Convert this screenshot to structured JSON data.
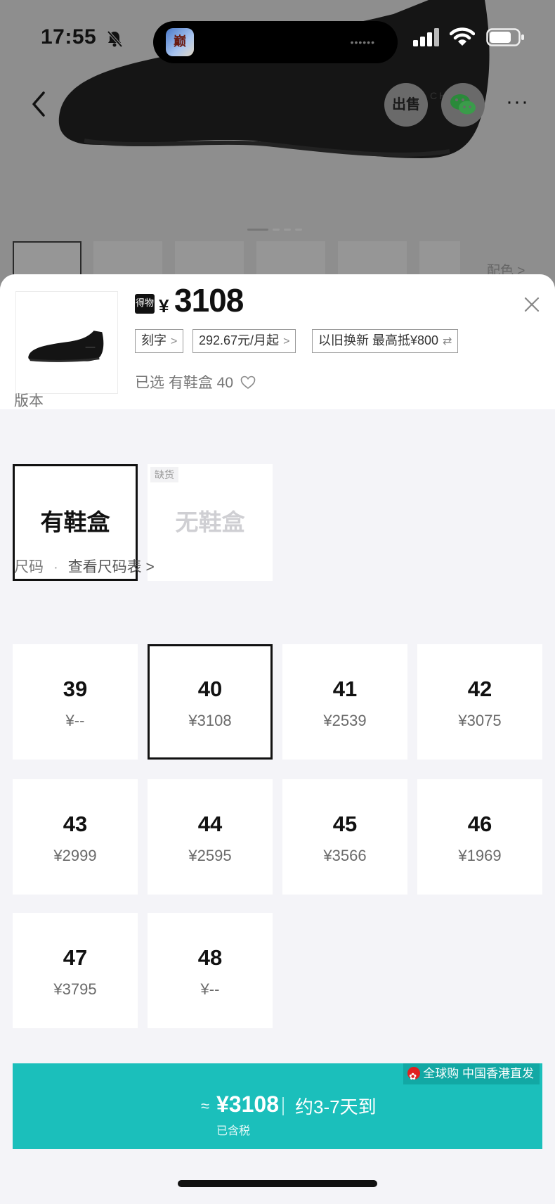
{
  "status_bar": {
    "time": "17:55"
  },
  "background_page": {
    "sell_label": "出售",
    "brand_fragment": "CH",
    "more_label": "···",
    "color_link": "配色 >"
  },
  "sheet": {
    "badge_label": "得物",
    "currency": "¥",
    "price": "3108",
    "tags": [
      {
        "label": "刻字",
        "chevron": ">"
      },
      {
        "label": "292.67元/月起",
        "chevron": ">"
      },
      {
        "label": "以旧换新 最高抵¥800",
        "chevron": "⇄"
      }
    ],
    "selected_info": "已选 有鞋盒 40"
  },
  "version_section": {
    "label": "版本",
    "options": [
      {
        "label": "有鞋盒",
        "state": "selected"
      },
      {
        "label": "无鞋盒",
        "state": "disabled",
        "tag": "缺货"
      }
    ]
  },
  "size_section": {
    "label": "尺码",
    "separator": "·",
    "size_chart_link": "查看尺码表 >",
    "sizes": [
      {
        "size": "39",
        "price": "¥--"
      },
      {
        "size": "40",
        "price": "¥3108",
        "selected": true
      },
      {
        "size": "41",
        "price": "¥2539"
      },
      {
        "size": "42",
        "price": "¥3075"
      },
      {
        "size": "43",
        "price": "¥2999"
      },
      {
        "size": "44",
        "price": "¥2595"
      },
      {
        "size": "45",
        "price": "¥3566"
      },
      {
        "size": "46",
        "price": "¥1969"
      },
      {
        "size": "47",
        "price": "¥3795"
      },
      {
        "size": "48",
        "price": "¥--"
      }
    ]
  },
  "buy_button": {
    "badge": "全球购 中国香港直发",
    "approx": "≈",
    "price": "¥3108",
    "delivery": "约3-7天到",
    "tax_note": "已含税"
  },
  "colors": {
    "accent": "#1bbfbb",
    "accent_dark": "#12a8a4",
    "selected_border": "#111111",
    "sheet_background": "#f4f4f8"
  }
}
